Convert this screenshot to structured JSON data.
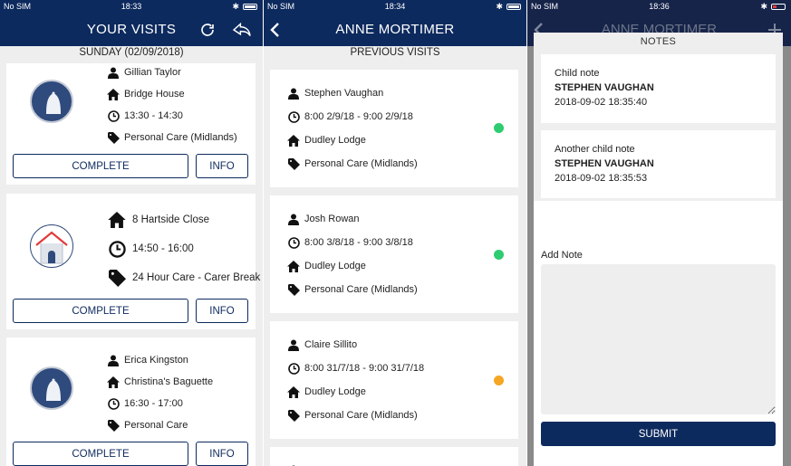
{
  "screens": [
    {
      "status": {
        "carrier": "No SIM",
        "time": "18:33"
      },
      "title": "YOUR VISITS",
      "date": "SUNDAY (02/09/2018)",
      "visits": [
        {
          "avatar_icon": "user-silhouette-icon",
          "name": "Gillian Taylor",
          "place": "Bridge House",
          "time": "13:30 - 14:30",
          "care": "Personal Care (Midlands)",
          "complete": "COMPLETE",
          "info": "INFO"
        },
        {
          "avatar_icon": "house-icon",
          "place": "8  Hartside Close",
          "time": "14:50 - 16:00",
          "care": "24 Hour Care - Carer Break",
          "complete": "COMPLETE",
          "info": "INFO"
        },
        {
          "avatar_icon": "user-silhouette-icon",
          "name": "Erica Kingston",
          "place": "Christina's Baguette",
          "time": "16:30 - 17:00",
          "care": "Personal Care",
          "complete": "COMPLETE",
          "info": "INFO"
        }
      ]
    },
    {
      "status": {
        "carrier": "No SIM",
        "time": "18:34"
      },
      "title": "ANNE MORTIMER",
      "subtitle": "PREVIOUS VISITS",
      "visits": [
        {
          "name": "Stephen Vaughan",
          "datetime": "8:00 2/9/18 - 9:00 2/9/18",
          "place": "Dudley Lodge",
          "care": "Personal Care (Midlands)",
          "status_color": "#2ecc71"
        },
        {
          "name": "Josh Rowan",
          "datetime": "8:00 3/8/18 - 9:00 3/8/18",
          "place": "Dudley Lodge",
          "care": "Personal Care (Midlands)",
          "status_color": "#2ecc71"
        },
        {
          "name": "Claire Sillito",
          "datetime": "8:00 31/7/18 - 9:00 31/7/18",
          "place": "Dudley Lodge",
          "care": "Personal Care (Midlands)",
          "status_color": "#f5a623"
        }
      ]
    },
    {
      "status": {
        "carrier": "No SIM",
        "time": "18:36"
      },
      "title": "ANNE MORTIMER",
      "modal_title": "NOTES",
      "notes": [
        {
          "title": "Child note",
          "author": "STEPHEN VAUGHAN",
          "timestamp": "2018-09-02 18:35:40"
        },
        {
          "title": "Another child note",
          "author": "STEPHEN VAUGHAN",
          "timestamp": "2018-09-02 18:35:53"
        }
      ],
      "add_note_label": "Add Note",
      "submit_label": "SUBMIT"
    }
  ],
  "colors": {
    "brand": "#0d2a5e",
    "status_green": "#2ecc71",
    "status_amber": "#f5a623"
  }
}
